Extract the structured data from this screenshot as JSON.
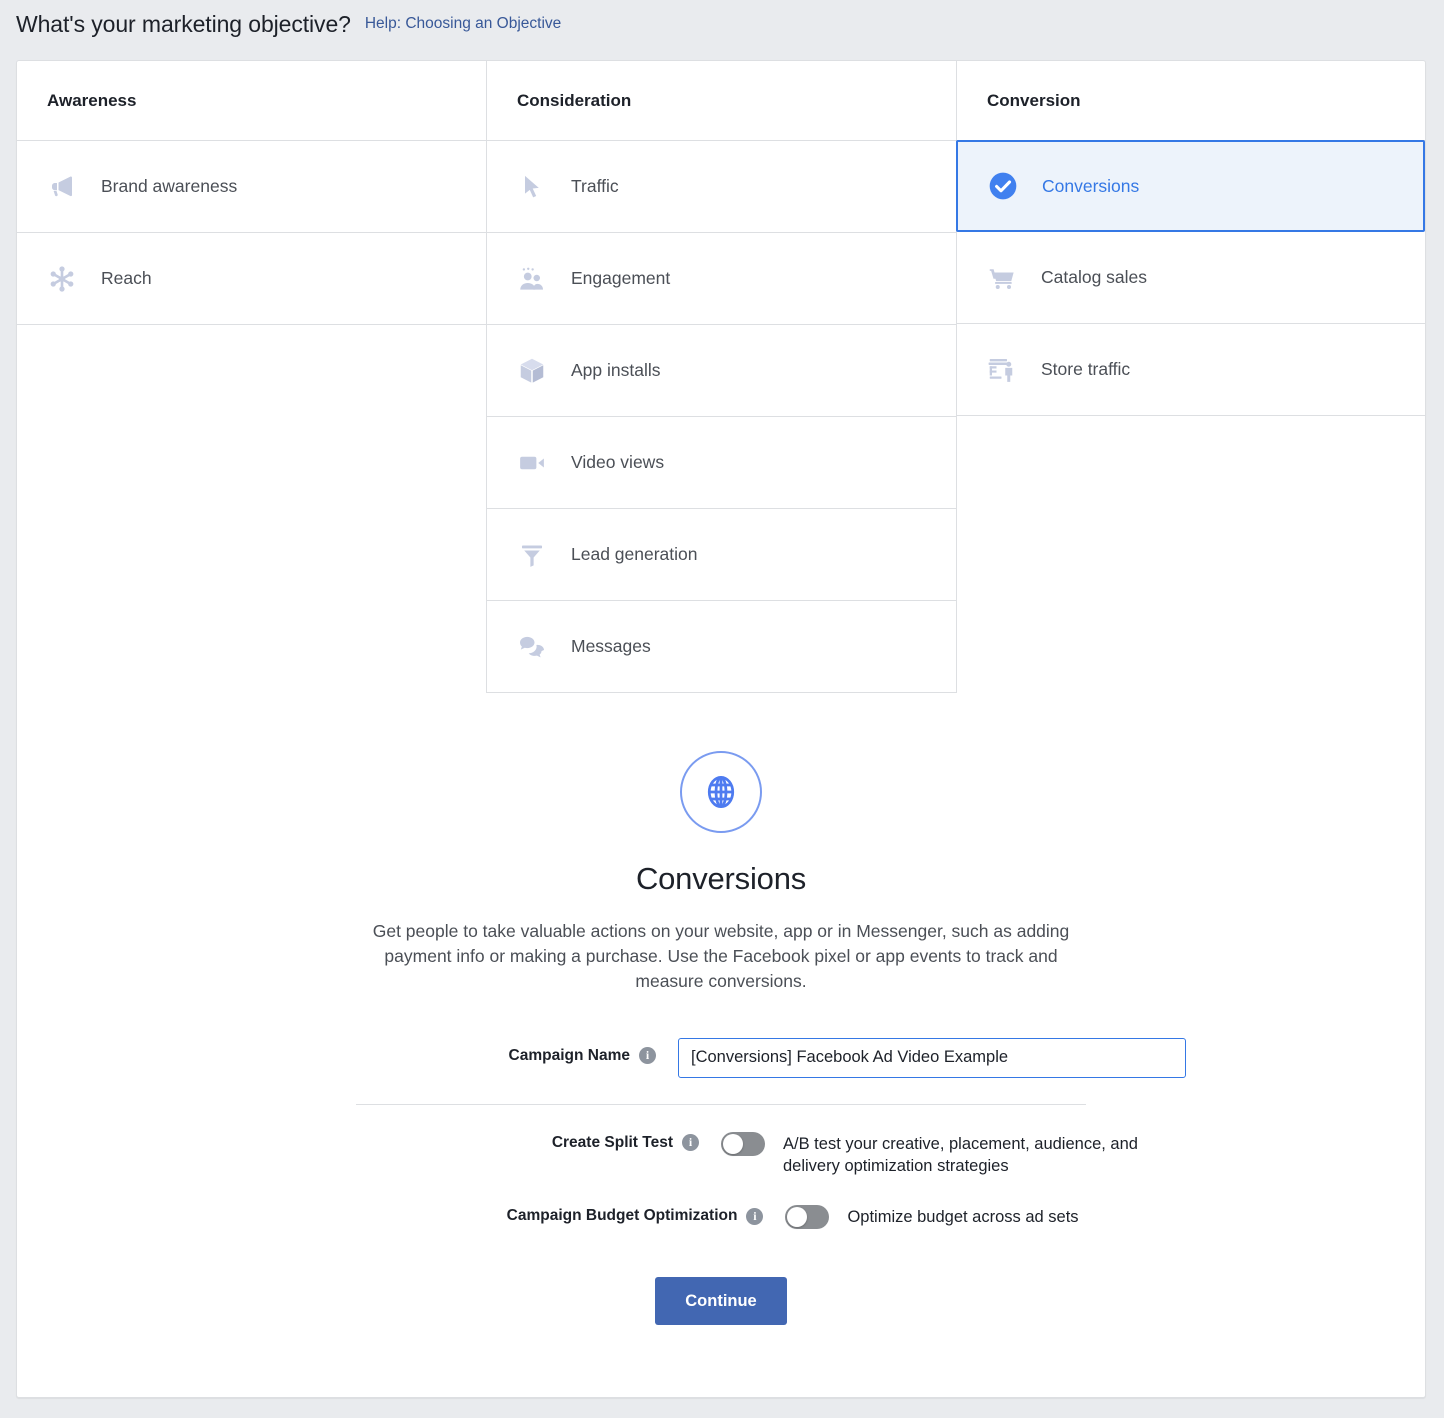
{
  "header": {
    "title": "What's your marketing objective?",
    "help_link": "Help: Choosing an Objective"
  },
  "objective_grid": {
    "columns": [
      {
        "heading": "Awareness",
        "items": [
          {
            "label": "Brand awareness",
            "icon": "megaphone-icon",
            "selected": false
          },
          {
            "label": "Reach",
            "icon": "reach-icon",
            "selected": false
          }
        ]
      },
      {
        "heading": "Consideration",
        "items": [
          {
            "label": "Traffic",
            "icon": "cursor-icon",
            "selected": false
          },
          {
            "label": "Engagement",
            "icon": "people-icon",
            "selected": false
          },
          {
            "label": "App installs",
            "icon": "cube-icon",
            "selected": false
          },
          {
            "label": "Video views",
            "icon": "video-camera-icon",
            "selected": false
          },
          {
            "label": "Lead generation",
            "icon": "funnel-icon",
            "selected": false
          },
          {
            "label": "Messages",
            "icon": "speech-bubbles-icon",
            "selected": false
          }
        ]
      },
      {
        "heading": "Conversion",
        "items": [
          {
            "label": "Conversions",
            "icon": "check-circle-icon",
            "selected": true
          },
          {
            "label": "Catalog sales",
            "icon": "shopping-cart-icon",
            "selected": false
          },
          {
            "label": "Store traffic",
            "icon": "storefront-icon",
            "selected": false
          }
        ]
      }
    ]
  },
  "detail": {
    "icon": "globe-icon",
    "title": "Conversions",
    "description": "Get people to take valuable actions on your website, app or in Messenger, such as adding payment info or making a purchase. Use the Facebook pixel or app events to track and measure conversions."
  },
  "form": {
    "campaign_name": {
      "label": "Campaign Name",
      "value": "[Conversions] Facebook Ad Video Example",
      "placeholder": "Campaign Name"
    },
    "split_test": {
      "label": "Create Split Test",
      "description": "A/B test your creative, placement, audience, and delivery optimization strategies",
      "state": "off"
    },
    "budget_optimization": {
      "label": "Campaign Budget Optimization",
      "description": "Optimize budget across ad sets",
      "state": "off"
    },
    "continue_label": "Continue"
  },
  "colors": {
    "accent_blue": "#3578e5",
    "button_blue": "#4267b2",
    "selected_bg": "#edf3fb",
    "icon_gray": "#c5cce0",
    "page_bg": "#e9ebee"
  }
}
